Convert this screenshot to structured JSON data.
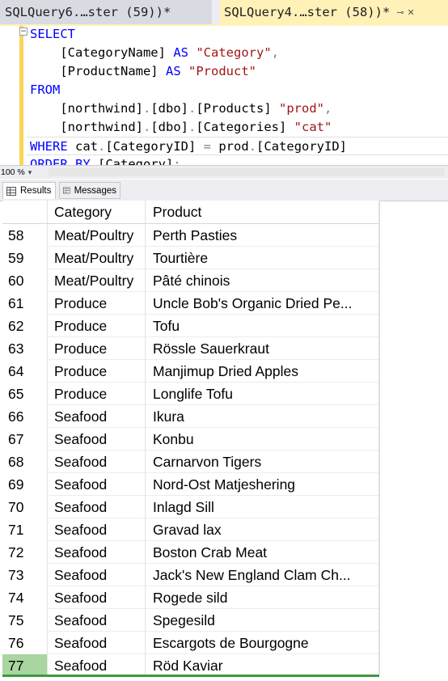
{
  "tabs": [
    {
      "label": "SQLQuery6.…ster (59))*",
      "active": false
    },
    {
      "label": "SQLQuery4.…ster (58))*",
      "active": true
    }
  ],
  "editor": {
    "lines": [
      {
        "segments": [
          {
            "t": "SELECT",
            "c": "kw"
          }
        ]
      },
      {
        "segments": [
          {
            "t": "    [CategoryName] ",
            "c": ""
          },
          {
            "t": "AS",
            "c": "kw"
          },
          {
            "t": " ",
            "c": ""
          },
          {
            "t": "\"Category\"",
            "c": "str"
          },
          {
            "t": ",",
            "c": "op"
          }
        ]
      },
      {
        "segments": [
          {
            "t": "    [ProductName] ",
            "c": ""
          },
          {
            "t": "AS",
            "c": "kw"
          },
          {
            "t": " ",
            "c": ""
          },
          {
            "t": "\"Product\"",
            "c": "str"
          }
        ]
      },
      {
        "segments": [
          {
            "t": "FROM",
            "c": "kw"
          }
        ]
      },
      {
        "segments": [
          {
            "t": "    [northwind]",
            "c": ""
          },
          {
            "t": ".",
            "c": "op"
          },
          {
            "t": "[dbo]",
            "c": ""
          },
          {
            "t": ".",
            "c": "op"
          },
          {
            "t": "[Products] ",
            "c": ""
          },
          {
            "t": "\"prod\"",
            "c": "str"
          },
          {
            "t": ",",
            "c": "op"
          }
        ]
      },
      {
        "segments": [
          {
            "t": "    [northwind]",
            "c": ""
          },
          {
            "t": ".",
            "c": "op"
          },
          {
            "t": "[dbo]",
            "c": ""
          },
          {
            "t": ".",
            "c": "op"
          },
          {
            "t": "[Categories] ",
            "c": ""
          },
          {
            "t": "\"cat\"",
            "c": "str"
          }
        ]
      },
      {
        "segments": [
          {
            "t": "WHERE",
            "c": "kw"
          },
          {
            "t": " cat",
            "c": ""
          },
          {
            "t": ".",
            "c": "op"
          },
          {
            "t": "[CategoryID] ",
            "c": ""
          },
          {
            "t": "=",
            "c": "op"
          },
          {
            "t": " prod",
            "c": ""
          },
          {
            "t": ".",
            "c": "op"
          },
          {
            "t": "[CategoryID]",
            "c": ""
          }
        ]
      },
      {
        "segments": [
          {
            "t": "ORDER BY",
            "c": "kw"
          },
          {
            "t": " [Category]",
            "c": ""
          },
          {
            "t": ";",
            "c": "op"
          }
        ]
      }
    ]
  },
  "zoom": {
    "value": "100 %"
  },
  "results_tabs": [
    {
      "label": "Results",
      "selected": true
    },
    {
      "label": "Messages",
      "selected": false
    }
  ],
  "grid": {
    "columns": [
      "",
      "Category",
      "Product"
    ],
    "rows": [
      [
        "58",
        "Meat/Poultry",
        "Perth Pasties"
      ],
      [
        "59",
        "Meat/Poultry",
        "Tourtière"
      ],
      [
        "60",
        "Meat/Poultry",
        "Pâté chinois"
      ],
      [
        "61",
        "Produce",
        "Uncle Bob's Organic Dried Pe..."
      ],
      [
        "62",
        "Produce",
        "Tofu"
      ],
      [
        "63",
        "Produce",
        "Rössle Sauerkraut"
      ],
      [
        "64",
        "Produce",
        "Manjimup Dried Apples"
      ],
      [
        "65",
        "Produce",
        "Longlife Tofu"
      ],
      [
        "66",
        "Seafood",
        "Ikura"
      ],
      [
        "67",
        "Seafood",
        "Konbu"
      ],
      [
        "68",
        "Seafood",
        "Carnarvon Tigers"
      ],
      [
        "69",
        "Seafood",
        "Nord-Ost Matjeshering"
      ],
      [
        "70",
        "Seafood",
        "Inlagd Sill"
      ],
      [
        "71",
        "Seafood",
        "Gravad lax"
      ],
      [
        "72",
        "Seafood",
        "Boston Crab Meat"
      ],
      [
        "73",
        "Seafood",
        "Jack's New England Clam Ch..."
      ],
      [
        "74",
        "Seafood",
        "Rogede sild"
      ],
      [
        "75",
        "Seafood",
        "Spegesild"
      ],
      [
        "76",
        "Seafood",
        "Escargots de Bourgogne"
      ],
      [
        "77",
        "Seafood",
        "Röd Kaviar"
      ]
    ]
  },
  "colors": {
    "keyword": "#0000ff",
    "string": "#a31515",
    "active_tab": "#fff1b8",
    "selected_row": "#a8d5a0"
  }
}
